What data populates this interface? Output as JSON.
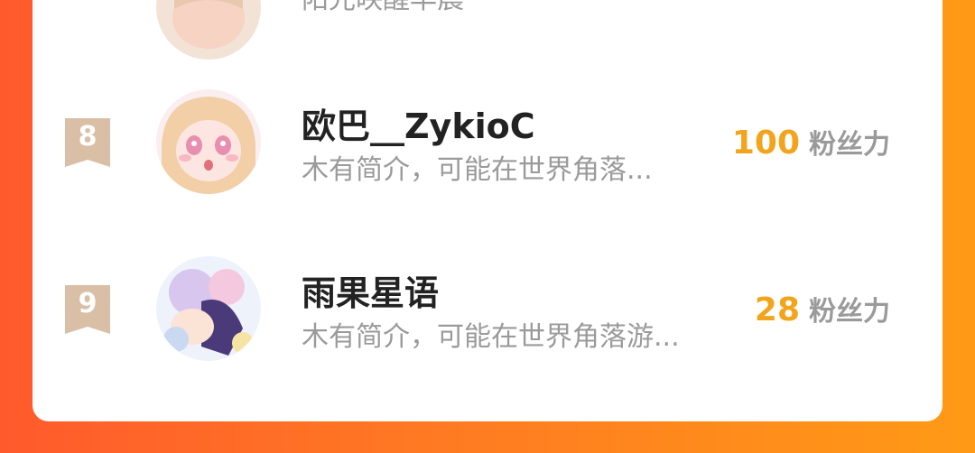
{
  "ranking": {
    "items": [
      {
        "rank": "",
        "name": "",
        "bio": "阳光映醒早晨",
        "fans_count": "",
        "fans_label": ""
      },
      {
        "rank": "8",
        "name": "欧巴__ZykioC",
        "bio": "木有简介，可能在世界角落...",
        "fans_count": "100",
        "fans_label": "粉丝力"
      },
      {
        "rank": "9",
        "name": "雨果星语",
        "bio": "木有简介，可能在世界角落游...",
        "fans_count": "28",
        "fans_label": "粉丝力"
      }
    ]
  },
  "colors": {
    "background_start": "#ff5a2c",
    "background_end": "#ff9a16",
    "card": "#ffffff",
    "rank_badge": "#d8bfa6",
    "fans_count": "#f2a41d",
    "name": "#222222",
    "muted": "#9a9a9a"
  }
}
